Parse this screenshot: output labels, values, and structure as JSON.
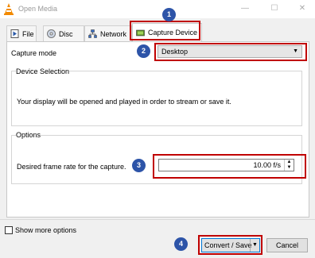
{
  "window": {
    "title": "Open Media",
    "minimize": "—",
    "maximize": "☐",
    "close": "✕"
  },
  "tabs": [
    {
      "label": "File",
      "icon": "file-icon"
    },
    {
      "label": "Disc",
      "icon": "disc-icon"
    },
    {
      "label": "Network",
      "icon": "network-icon"
    },
    {
      "label": "Capture Device",
      "icon": "capture-device-icon",
      "selected": true
    }
  ],
  "capture": {
    "mode_label": "Capture mode",
    "mode_value": "Desktop"
  },
  "device_selection": {
    "title": "Device Selection",
    "text": "Your display will be opened and played in order to stream or save it."
  },
  "options": {
    "title": "Options",
    "frame_rate_label": "Desired frame rate for the capture.",
    "frame_rate_value": "10.00 f/s"
  },
  "footer": {
    "show_more_label": "Show more options",
    "convert_label": "Convert / Save",
    "cancel_label": "Cancel"
  },
  "annotations": {
    "badges": [
      "1",
      "2",
      "3",
      "4"
    ],
    "highlight_color": "#c00000",
    "badge_color": "#2d54a8"
  }
}
